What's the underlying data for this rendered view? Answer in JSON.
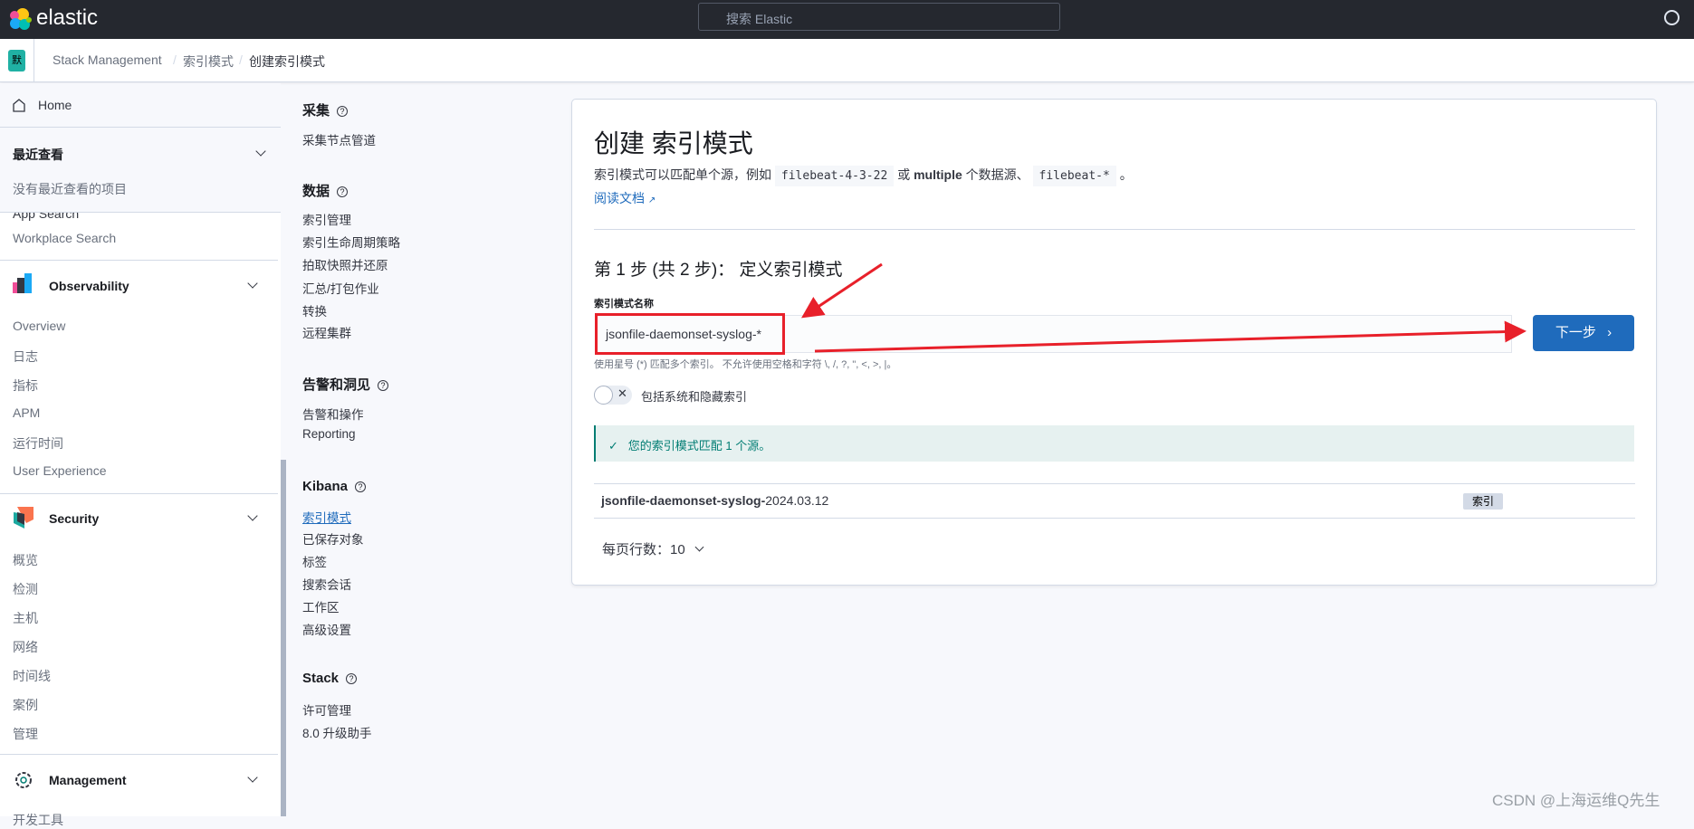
{
  "header": {
    "logo": "elastic",
    "search_placeholder": "搜索 Elastic"
  },
  "breadcrumb": {
    "space": "默",
    "items": [
      "Stack Management",
      "索引模式",
      "创建索引模式"
    ]
  },
  "sidebar": {
    "home": "Home",
    "recent_title": "最近查看",
    "recent_empty": "没有最近查看的项目",
    "app_search_partial": "App Search",
    "workplace": "Workplace Search",
    "observability": {
      "title": "Observability",
      "items": [
        "Overview",
        "日志",
        "指标",
        "APM",
        "运行时间",
        "User Experience"
      ]
    },
    "security": {
      "title": "Security",
      "items": [
        "概览",
        "检测",
        "主机",
        "网络",
        "时间线",
        "案例",
        "管理"
      ]
    },
    "management": {
      "title": "Management",
      "partial": "开发工具"
    }
  },
  "mgmt_nav": {
    "sections": [
      {
        "title": "采集",
        "items": [
          "采集节点管道"
        ]
      },
      {
        "title": "数据",
        "items": [
          "索引管理",
          "索引生命周期策略",
          "拍取快照并还原",
          "汇总/打包作业",
          "转换",
          "远程集群"
        ]
      },
      {
        "title": "告警和洞见",
        "items": [
          "告警和操作",
          "Reporting"
        ]
      },
      {
        "title": "Kibana",
        "items": [
          "索引模式",
          "已保存对象",
          "标签",
          "搜索会话",
          "工作区",
          "高级设置"
        ]
      },
      {
        "title": "Stack",
        "items": [
          "许可管理",
          "8.0 升级助手"
        ]
      }
    ]
  },
  "card": {
    "title": "创建 索引模式",
    "desc_1": "索引模式可以匹配单个源，例如",
    "code_1": "filebeat-4-3-22",
    "desc_2": "或",
    "desc_bold": "multiple",
    "desc_3": "个数据源、",
    "code_2": "filebeat-*",
    "desc_4": "。",
    "doc_link": "阅读文档",
    "step_title": "第 1 步 (共 2 步)： 定义索引模式",
    "field_label": "索引模式名称",
    "field_value": "jsonfile-daemonset-syslog-*",
    "next_button": "下一步",
    "help_text": "使用星号 (*) 匹配多个索引。 不允许使用空格和字符 \\, /, ?, \", <, >, |。",
    "toggle_label": "包括系统和隐藏索引",
    "toggle_on": false,
    "callout": "您的索引模式匹配 1 个源。",
    "row": {
      "name_bold": "jsonfile-daemonset-syslog-",
      "name_rest": "2024.03.12",
      "badge": "索引"
    },
    "pagination": "每页行数：10"
  },
  "watermark": "CSDN @上海运维Q先生",
  "colors": {
    "accent": "#1f6bbc",
    "success": "#017d73",
    "annotation": "#e8202a"
  }
}
